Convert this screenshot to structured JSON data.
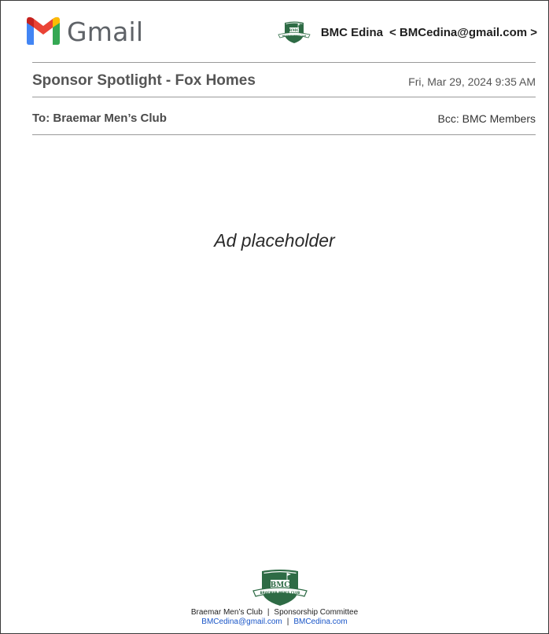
{
  "header": {
    "app_name": "Gmail",
    "sender_name": "BMC Edina",
    "sender_email": "< BMCedina@gmail.com >",
    "logo_text": "BMC",
    "logo_subtext": "BRAEMAR MEN'S CLUB"
  },
  "message": {
    "subject": "Sponsor Spotlight - Fox Homes",
    "date": "Fri, Mar 29, 2024 9:35 AM",
    "to": "To:  Braemar Men’s Club",
    "bcc": "Bcc:  BMC Members",
    "body_placeholder": "Ad placeholder"
  },
  "footer": {
    "club_name": "Braemar Men’s Club",
    "committee": "Sponsorship Committee",
    "separator": "|",
    "email": "BMCedina@gmail.com",
    "website": "BMCedina.com",
    "logo_text": "BMC",
    "logo_subtext": "BRAEMAR MEN'S CLUB"
  },
  "colors": {
    "gmail_red": "#ea4335",
    "gmail_blue": "#4285f4",
    "gmail_green": "#34a853",
    "gmail_yellow": "#fbbc04",
    "bmc_green": "#2e6b45",
    "link_blue": "#1a56c8"
  }
}
